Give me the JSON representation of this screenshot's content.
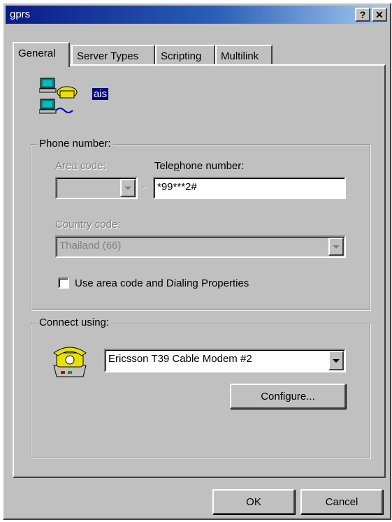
{
  "window": {
    "title": "gprs",
    "help_label": "?",
    "close_label": "✕"
  },
  "tabs": [
    {
      "label": "General"
    },
    {
      "label": "Server Types"
    },
    {
      "label": "Scripting"
    },
    {
      "label": "Multilink"
    }
  ],
  "connection_name": "ais",
  "phone": {
    "group_label": "Phone number:",
    "area_code_label": "Area code:",
    "area_code_value": "",
    "dash": "-",
    "telephone_label": "Telephone number:",
    "telephone_value": "*99***2#",
    "country_code_label": "Country code:",
    "country_code_value": "Thailand (66)",
    "use_area_code_label": "Use area code and Dialing Properties",
    "use_area_code_checked": false
  },
  "connect": {
    "group_label": "Connect using:",
    "device_value": "Ericsson T39 Cable Modem #2",
    "configure_label": "Configure..."
  },
  "footer": {
    "ok_label": "OK",
    "cancel_label": "Cancel"
  }
}
